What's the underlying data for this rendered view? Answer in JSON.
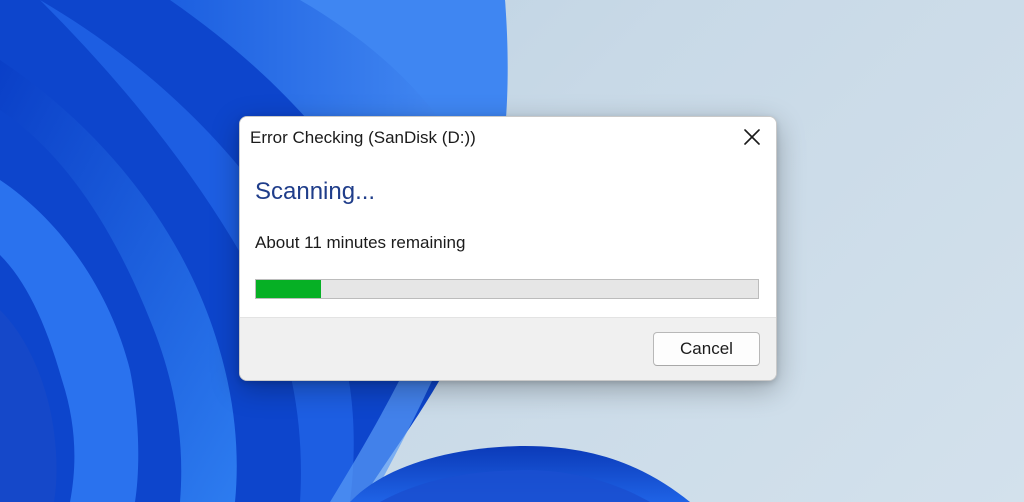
{
  "dialog": {
    "title": "Error Checking (SanDisk (D:))",
    "heading": "Scanning...",
    "status": "About 11 minutes remaining",
    "progress_fraction": 0.13,
    "cancel_label": "Cancel"
  },
  "icons": {
    "close": "close-icon"
  },
  "colors": {
    "progress_fill": "#06b025",
    "heading": "#1f3d8a",
    "wallpaper_blue": "#1a56d6"
  }
}
